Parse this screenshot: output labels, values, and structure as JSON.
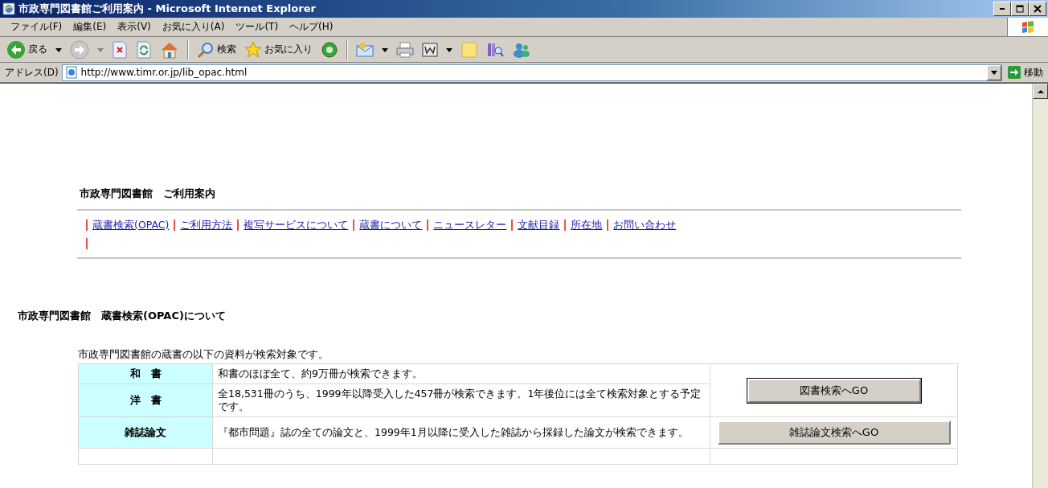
{
  "window": {
    "title": "市政専門図書館ご利用案内 - Microsoft Internet Explorer"
  },
  "menu": [
    "ファイル(F)",
    "編集(E)",
    "表示(V)",
    "お気に入り(A)",
    "ツール(T)",
    "ヘルプ(H)"
  ],
  "toolbar": {
    "back": "戻る",
    "search": "検索",
    "favorites": "お気に入り"
  },
  "address": {
    "label": "アドレス(D)",
    "value": "http://www.timr.or.jp/lib_opac.html",
    "go": "移動"
  },
  "page": {
    "heading": "市政専門図書館　ご利用案内",
    "nav": [
      "蔵書検索(OPAC)",
      "ご利用方法",
      "複写サービスについて",
      "蔵書について",
      "ニュースレター",
      "文献目録",
      "所在地",
      "お問い合わせ"
    ],
    "section_title": "市政専門図書館　蔵書検索(OPAC)について",
    "intro": "市政専門図書館の蔵書の以下の資料が検索対象です。",
    "rows": [
      {
        "category": "和　書",
        "description": "和書のほぼ全て、約9万冊が検索できます。",
        "button": {
          "label": "図書検索へGO",
          "default": true
        }
      },
      {
        "category": "洋　書",
        "description": "全18,531冊のうち、1999年以降受入した457冊が検索できます。1年後位には全て検索対象とする予定です。"
      },
      {
        "category": "雑誌論文",
        "description": "『都市問題』誌の全ての論文と、1999年1月以降に受入した雑誌から採録した論文が検索できます。",
        "button": {
          "label": "雑誌論文検索へGO",
          "default": false
        }
      }
    ]
  }
}
